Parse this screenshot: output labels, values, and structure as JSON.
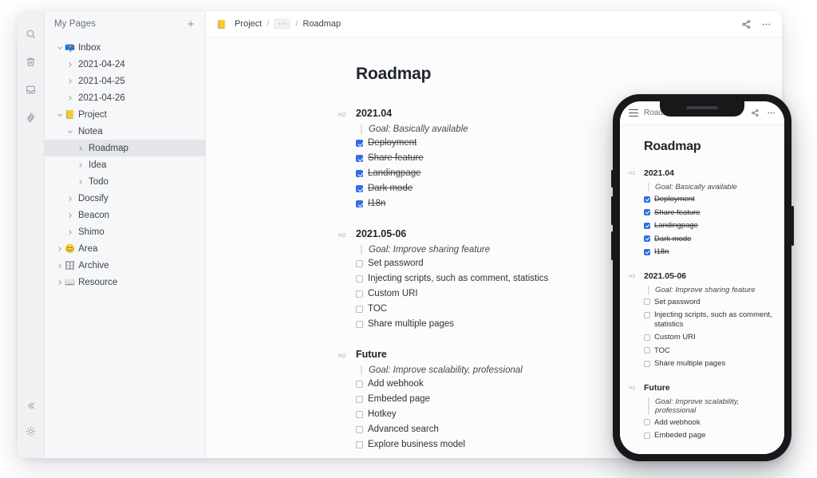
{
  "rail": {
    "top_items": [
      {
        "name": "search-icon",
        "label": "Search"
      },
      {
        "name": "trash-icon",
        "label": "Trash"
      },
      {
        "name": "inbox-icon",
        "label": "Inbox"
      },
      {
        "name": "settings-icon",
        "label": "Settings"
      }
    ],
    "bottom_items": [
      {
        "name": "collapse-sidebar-icon",
        "label": "Collapse"
      },
      {
        "name": "theme-toggle-icon",
        "label": "Theme"
      }
    ]
  },
  "sidebar": {
    "title": "My Pages",
    "add_label": "+",
    "items": [
      {
        "label": "Inbox",
        "emoji": "📪",
        "indent": 0,
        "expanded": true,
        "selected": false
      },
      {
        "label": "2021-04-24",
        "emoji": "",
        "indent": 1,
        "expanded": false,
        "selected": false
      },
      {
        "label": "2021-04-25",
        "emoji": "",
        "indent": 1,
        "expanded": false,
        "selected": false
      },
      {
        "label": "2021-04-26",
        "emoji": "",
        "indent": 1,
        "expanded": false,
        "selected": false
      },
      {
        "label": "Project",
        "emoji": "📒",
        "indent": 0,
        "expanded": true,
        "selected": false
      },
      {
        "label": "Notea",
        "emoji": "",
        "indent": 1,
        "expanded": true,
        "selected": false
      },
      {
        "label": "Roadmap",
        "emoji": "",
        "indent": 2,
        "expanded": false,
        "selected": true
      },
      {
        "label": "Idea",
        "emoji": "",
        "indent": 2,
        "expanded": false,
        "selected": false
      },
      {
        "label": "Todo",
        "emoji": "",
        "indent": 2,
        "expanded": false,
        "selected": false
      },
      {
        "label": "Docsify",
        "emoji": "",
        "indent": 1,
        "expanded": false,
        "selected": false
      },
      {
        "label": "Beacon",
        "emoji": "",
        "indent": 1,
        "expanded": false,
        "selected": false
      },
      {
        "label": "Shimo",
        "emoji": "",
        "indent": 1,
        "expanded": false,
        "selected": false
      },
      {
        "label": "Area",
        "emoji": "😊",
        "indent": 0,
        "expanded": false,
        "selected": false
      },
      {
        "label": "Archive",
        "emoji": "🗄",
        "indent": 0,
        "expanded": false,
        "selected": false
      },
      {
        "label": "Resource",
        "emoji": "📖",
        "indent": 0,
        "expanded": false,
        "selected": false
      }
    ]
  },
  "topbar": {
    "breadcrumb": {
      "root_emoji": "📒",
      "root": "Project",
      "sep1": "/",
      "ellipsis": "···",
      "sep2": "/",
      "current": "Roadmap"
    },
    "icons": [
      {
        "name": "share-icon",
        "label": "Share"
      },
      {
        "name": "more-icon",
        "label": "More"
      }
    ]
  },
  "document": {
    "title": "Roadmap",
    "h2_marker": "H2",
    "sections": [
      {
        "heading": "2021.04",
        "goal": "Goal: Basically available",
        "tasks": [
          {
            "label": "Deployment",
            "checked": true
          },
          {
            "label": "Share feature",
            "checked": true
          },
          {
            "label": "Landingpage",
            "checked": true
          },
          {
            "label": "Dark mode",
            "checked": true
          },
          {
            "label": "I18n",
            "checked": true
          }
        ]
      },
      {
        "heading": "2021.05-06",
        "goal": "Goal: Improve sharing feature",
        "tasks": [
          {
            "label": "Set password",
            "checked": false
          },
          {
            "label": "Injecting scripts, such as comment, statistics",
            "checked": false
          },
          {
            "label": "Custom URI",
            "checked": false
          },
          {
            "label": "TOC",
            "checked": false
          },
          {
            "label": "Share multiple pages",
            "checked": false
          }
        ]
      },
      {
        "heading": "Future",
        "goal": "Goal: Improve scalability, professional",
        "tasks": [
          {
            "label": "Add webhook",
            "checked": false
          },
          {
            "label": "Embeded page",
            "checked": false
          },
          {
            "label": "Hotkey",
            "checked": false
          },
          {
            "label": "Advanced search",
            "checked": false
          },
          {
            "label": "Explore business model",
            "checked": false
          }
        ]
      }
    ]
  },
  "phone": {
    "bar": {
      "menu_icon": "hamburger-menu-icon",
      "title": "Roadmap",
      "icons": [
        {
          "name": "share-icon",
          "label": "Share"
        },
        {
          "name": "more-icon",
          "label": "More"
        }
      ]
    },
    "document": {
      "title": "Roadmap",
      "h2_marker": "H2",
      "sections": [
        {
          "heading": "2021.04",
          "goal": "Goal: Basically available",
          "tasks": [
            {
              "label": "Deployment",
              "checked": true
            },
            {
              "label": "Share feature",
              "checked": true
            },
            {
              "label": "Landingpage",
              "checked": true
            },
            {
              "label": "Dark mode",
              "checked": true
            },
            {
              "label": "I18n",
              "checked": true
            }
          ]
        },
        {
          "heading": "2021.05-06",
          "goal": "Goal: Improve sharing feature",
          "tasks": [
            {
              "label": "Set password",
              "checked": false
            },
            {
              "label": "Injecting scripts, such as comment, statistics",
              "checked": false
            },
            {
              "label": "Custom URI",
              "checked": false
            },
            {
              "label": "TOC",
              "checked": false
            },
            {
              "label": "Share multiple pages",
              "checked": false
            }
          ]
        },
        {
          "heading": "Future",
          "goal": "Goal: Improve scalability, professional",
          "tasks": [
            {
              "label": "Add webhook",
              "checked": false
            },
            {
              "label": "Embeded page",
              "checked": false
            }
          ]
        }
      ]
    }
  },
  "colors": {
    "accent": "#2f6fe4",
    "sidebar_bg": "#f6f7f8",
    "rail_bg": "#f0f1f3",
    "selected_row": "#e3e5e8",
    "text": "#2c3238",
    "muted": "#8b9199",
    "phone_frame": "#17181a"
  }
}
